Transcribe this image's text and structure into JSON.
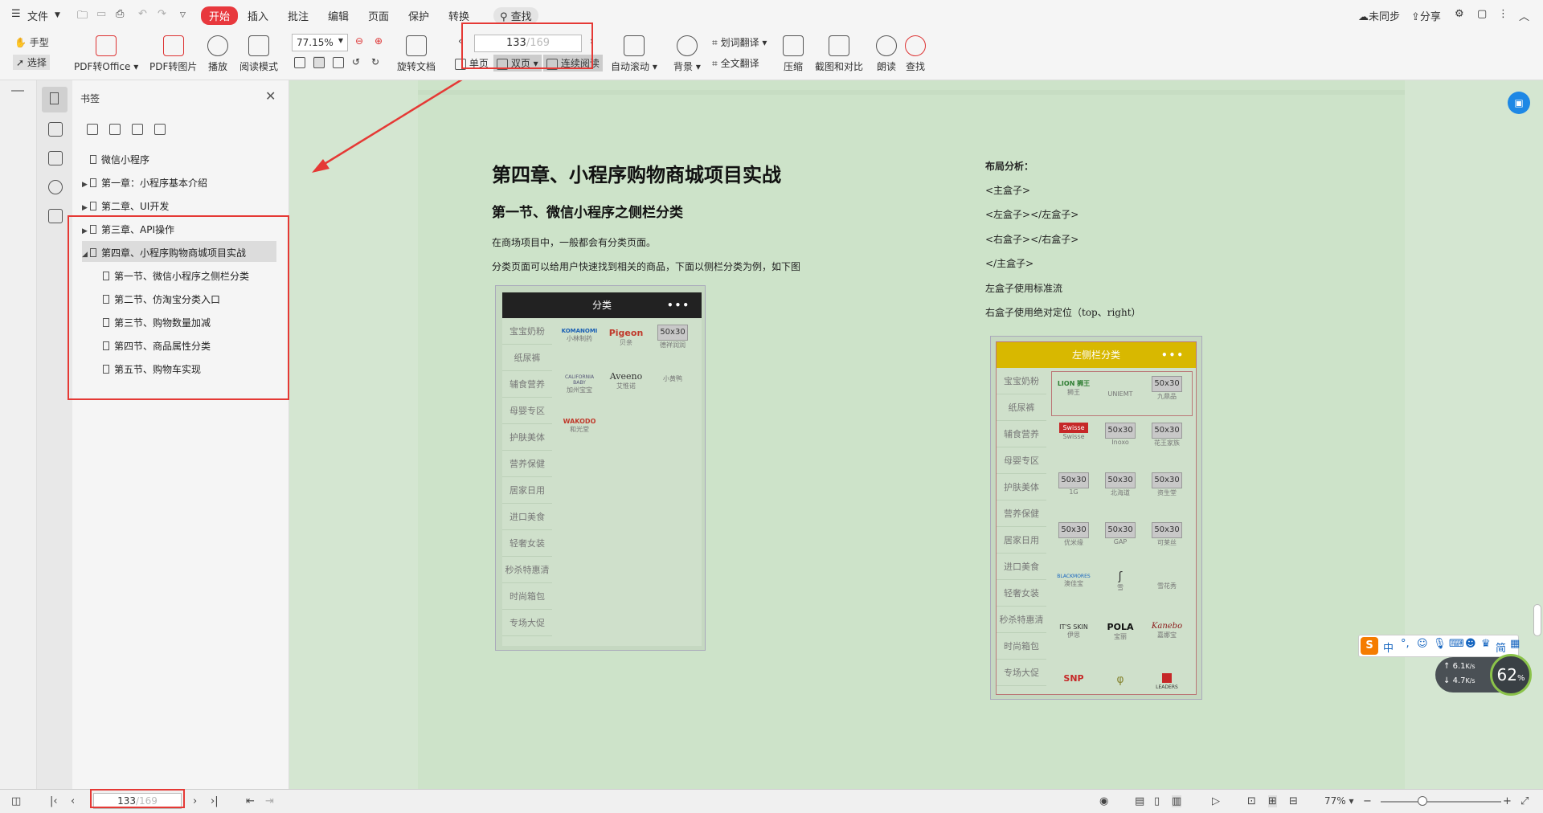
{
  "menu": {
    "file": "文件",
    "items": [
      "开始",
      "插入",
      "批注",
      "编辑",
      "页面",
      "保护",
      "转换"
    ],
    "search": "查找",
    "sync": "未同步",
    "share": "分享"
  },
  "ribbon": {
    "hand": "手型",
    "select": "选择",
    "pdf_office": "PDF转Office",
    "pdf_image": "PDF转图片",
    "play": "播放",
    "read_mode": "阅读模式",
    "zoom": "77.15%",
    "rotate": "旋转文档",
    "page_current": "133",
    "page_total": "/169",
    "single": "单页",
    "double": "双页",
    "continuous": "连续阅读",
    "auto_scroll": "自动滚动",
    "background": "背景",
    "word_translate": "划词翻译",
    "full_translate": "全文翻译",
    "compress": "压缩",
    "screenshot_compare": "截图和对比",
    "read_aloud": "朗读",
    "find": "查找"
  },
  "sidebar": {
    "title": "书签",
    "bookmarks": [
      {
        "label": "微信小程序",
        "level": 0,
        "arrow": ""
      },
      {
        "label": "第一章：小程序基本介绍",
        "level": 0,
        "arrow": "▶"
      },
      {
        "label": "第二章、UI开发",
        "level": 0,
        "arrow": "▶"
      },
      {
        "label": "第三章、API操作",
        "level": 0,
        "arrow": "▶"
      },
      {
        "label": "第四章、小程序购物商城项目实战",
        "level": 0,
        "arrow": "◢",
        "selected": true
      },
      {
        "label": "第一节、微信小程序之侧栏分类",
        "level": 1,
        "arrow": ""
      },
      {
        "label": "第二节、仿淘宝分类入口",
        "level": 1,
        "arrow": ""
      },
      {
        "label": "第三节、购物数量加减",
        "level": 1,
        "arrow": ""
      },
      {
        "label": "第四节、商品属性分类",
        "level": 1,
        "arrow": ""
      },
      {
        "label": "第五节、购物车实现",
        "level": 1,
        "arrow": ""
      }
    ]
  },
  "document": {
    "chapter_title": "第四章、小程序购物商城项目实战",
    "section_title": "第一节、微信小程序之侧栏分类",
    "para1": "在商场项目中，一般都会有分类页面。",
    "para2": "分类页面可以给用户快速找到相关的商品，下面以侧栏分类为例，如下图",
    "layout_title": "布局分析：",
    "layout_lines": [
      "<主盒子>",
      "<左盒子></左盒子>",
      "<右盒子></右盒子>",
      "</主盒子>",
      "左盒子使用标准流",
      "右盒子使用绝对定位（top、right）"
    ],
    "phone1_title": "分类",
    "phone2_title": "左侧栏分类",
    "categories": [
      "宝宝奶粉",
      "纸尿裤",
      "辅食营养",
      "母婴专区",
      "护肤美体",
      "营养保健",
      "居家日用",
      "进口美食",
      "轻奢女装",
      "秒杀特惠清",
      "时尚箱包",
      "专场大促"
    ],
    "phone1_brands": [
      {
        "name": "KOMANOMI",
        "sub": "小林制药"
      },
      {
        "name": "Pigeon",
        "sub": "贝亲"
      },
      {
        "name": "50x30",
        "sub": "德祥润润"
      },
      {
        "name": "CALIFORNIA BABY",
        "sub": "加州宝宝"
      },
      {
        "name": "Aveeno",
        "sub": "艾惟诺"
      },
      {
        "name": "",
        "sub": "小黄鸭"
      },
      {
        "name": "WAKODO",
        "sub": "和光堂"
      }
    ],
    "phone2_brands": [
      {
        "name": "LION 狮王",
        "sub": "狮王"
      },
      {
        "name": "",
        "sub": "UNIEMT"
      },
      {
        "name": "50x30",
        "sub": "九鼎品"
      },
      {
        "name": "Swisse",
        "sub": "Swisse"
      },
      {
        "name": "50x30",
        "sub": "Inoxo"
      },
      {
        "name": "50x30",
        "sub": "花王家族"
      },
      {
        "name": "50x30",
        "sub": "1G"
      },
      {
        "name": "50x30",
        "sub": "北海道"
      },
      {
        "name": "50x30",
        "sub": "资生堂"
      },
      {
        "name": "50x30",
        "sub": "优米缘"
      },
      {
        "name": "50x30",
        "sub": "GAP"
      },
      {
        "name": "50x30",
        "sub": "可莱丝"
      },
      {
        "name": "BLACKMORES",
        "sub": "澳佳宝"
      },
      {
        "name": "ʃ",
        "sub": "雪"
      },
      {
        "name": "",
        "sub": "雪花秀"
      },
      {
        "name": "IT'S SKIN",
        "sub": "伊思"
      },
      {
        "name": "POLA",
        "sub": "宝丽"
      },
      {
        "name": "Kanebo",
        "sub": "嘉娜宝"
      },
      {
        "name": "SNP",
        "sub": ""
      },
      {
        "name": "",
        "sub": ""
      },
      {
        "name": "LEADERS",
        "sub": ""
      }
    ]
  },
  "bottom": {
    "page_current": "133",
    "page_total": "/169",
    "zoom": "77%"
  },
  "ime": {
    "label": "中",
    "simplified": "简"
  },
  "net": {
    "up": "6.1",
    "down": "4.7",
    "unit": "K/s",
    "percent": "62",
    "pct_sign": "%"
  },
  "colors": {
    "accent": "#e8383d",
    "highlight": "#e53935",
    "page_bg": "#cde3c9",
    "phone_header_dark": "#222222",
    "phone_header_yellow": "#d8b800"
  }
}
